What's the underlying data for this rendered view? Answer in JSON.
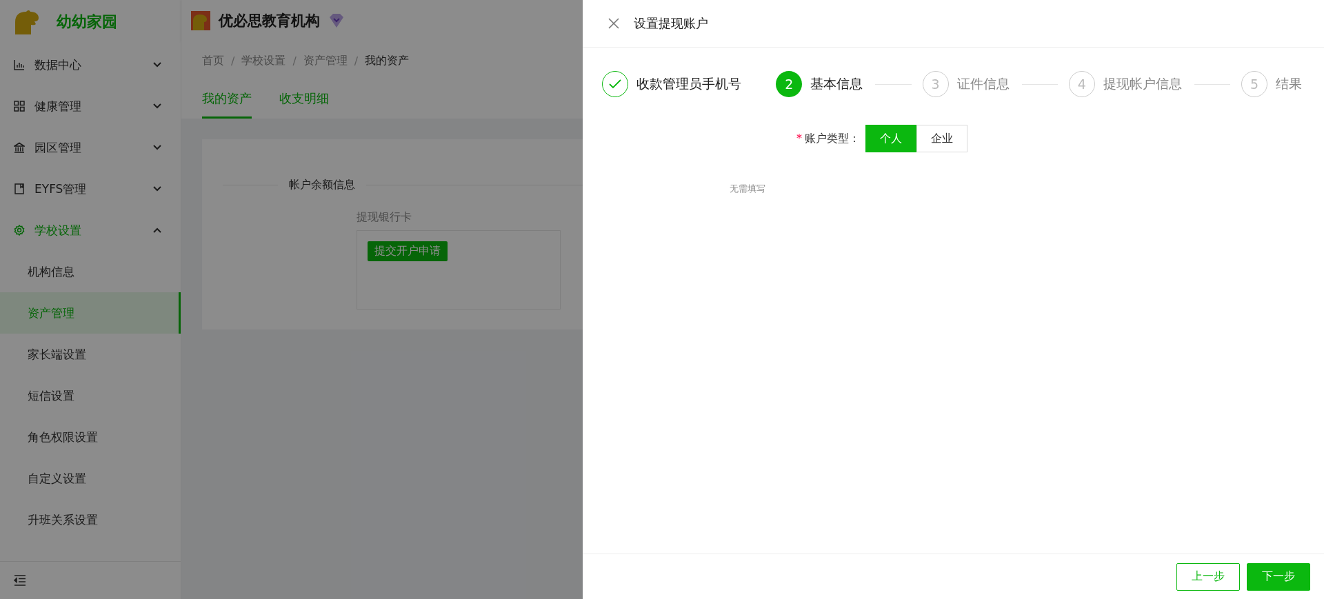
{
  "sidebar": {
    "brand": "幼幼家园",
    "menu": [
      {
        "label": "数据中心",
        "kind": "chart",
        "expanded": false,
        "active": false
      },
      {
        "label": "健康管理",
        "kind": "grid",
        "expanded": false,
        "active": false
      },
      {
        "label": "园区管理",
        "kind": "bank",
        "expanded": false,
        "active": false
      },
      {
        "label": "EYFS管理",
        "kind": "book",
        "expanded": false,
        "active": false
      },
      {
        "label": "学校设置",
        "kind": "gear",
        "expanded": true,
        "active": true,
        "children": [
          {
            "label": "机构信息",
            "selected": false
          },
          {
            "label": "资产管理",
            "selected": true
          },
          {
            "label": "家长端设置",
            "selected": false
          },
          {
            "label": "短信设置",
            "selected": false
          },
          {
            "label": "角色权限设置",
            "selected": false
          },
          {
            "label": "自定义设置",
            "selected": false
          },
          {
            "label": "升班关系设置",
            "selected": false
          }
        ]
      }
    ]
  },
  "header": {
    "org_name": "优必思教育机构"
  },
  "breadcrumbs": [
    {
      "label": "首页"
    },
    {
      "separator": "/",
      "label": "学校设置"
    },
    {
      "separator": "/",
      "label": "资产管理"
    },
    {
      "separator": "/",
      "label": "我的资产"
    }
  ],
  "tabs": [
    {
      "label": "我的资产",
      "selected": true
    },
    {
      "label": "收支明细",
      "selected": false
    }
  ],
  "card": {
    "section_title": "帐户余额信息",
    "field_label": "提现银行卡",
    "action_button": "提交开户申请"
  },
  "drawer": {
    "title": "设置提现账户",
    "steps": [
      {
        "label": "收款管理员手机号",
        "kind": "done"
      },
      {
        "number": "2",
        "label": "基本信息",
        "kind": "current"
      },
      {
        "number": "3",
        "label": "证件信息",
        "kind": "wait"
      },
      {
        "number": "4",
        "label": "提现帐户信息",
        "kind": "wait"
      },
      {
        "number": "5",
        "label": "结果",
        "kind": "wait"
      }
    ],
    "form": {
      "label": "账户类型：",
      "required_mark": "*",
      "options": [
        {
          "label": "个人",
          "selected": true
        },
        {
          "label": "企业",
          "selected": false
        }
      ]
    },
    "hint": "无需填写",
    "buttons": [
      {
        "label": "上一步",
        "kind": "secondary"
      },
      {
        "label": "下一步",
        "kind": "primary"
      }
    ]
  }
}
